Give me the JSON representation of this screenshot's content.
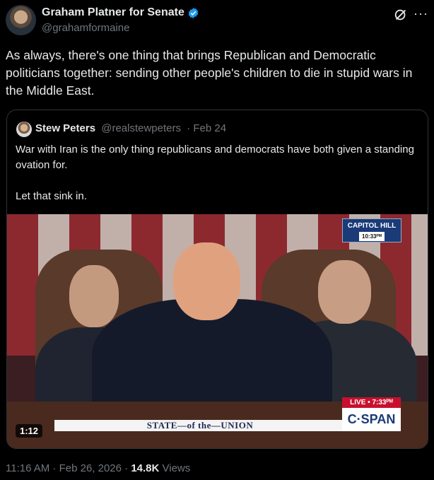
{
  "author": {
    "name": "Graham Platner for Senate",
    "handle": "@grahamformaine"
  },
  "icons": {
    "verified": "verified-badge-icon",
    "grok": "grok-icon",
    "more": "more-icon"
  },
  "tweet": {
    "text": "As always, there's one thing that brings Republican and Democratic politicians together: sending other people's children to die in stupid wars in the Middle East."
  },
  "quoted": {
    "name": "Stew Peters",
    "handle": "@realstewpeters",
    "date": "· Feb 24",
    "text": "War with Iran is the only thing republicans and democrats have both given a standing ovation for.\n\nLet that sink in."
  },
  "video": {
    "badge_location": "CAPITOL HILL",
    "badge_time": "10:33ᴾᴹ",
    "lower_third": "STATE—of the—UNION",
    "live_label": "LIVE • 7:33ᴾᴹ",
    "network": "C·SPAN",
    "duration": "1:12"
  },
  "meta": {
    "time": "11:16 AM · Feb 26, 2026 · ",
    "views_count": "14.8K",
    "views_label": " Views"
  },
  "colors": {
    "background": "#000000",
    "text": "#e7e9ea",
    "secondary": "#71767b",
    "verified": "#1d9bf0",
    "border": "#2f3336"
  }
}
